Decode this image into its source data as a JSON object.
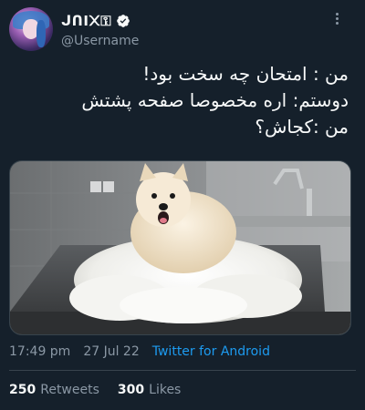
{
  "user": {
    "display_name": "ᒍᑎI᙭⚿",
    "username": "@Username",
    "verified": true,
    "avatar_icon": "avatar-icon"
  },
  "tweet": {
    "lines": [
      "من : امتحان چه سخت بود!",
      "دوستم: اره مخصوصا صفحه پشتش",
      "من :کجاش؟"
    ]
  },
  "meta": {
    "time": "17:49 pm",
    "date": "27 Jul 22",
    "source": "Twitter for Android"
  },
  "stats": {
    "retweets_count": "250",
    "retweets_label": "Retweets",
    "likes_count": "300",
    "likes_label": "Likes"
  },
  "colors": {
    "background": "#15202b",
    "text": "#f7f9f9",
    "muted": "#8b98a5",
    "accent": "#1d9bf0",
    "divider": "#38444d"
  }
}
